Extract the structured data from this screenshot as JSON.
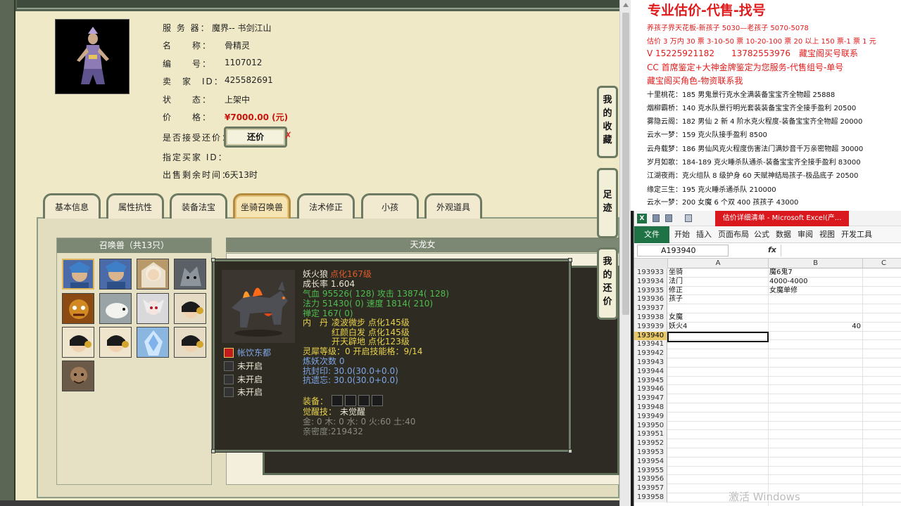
{
  "game": {
    "info": {
      "server_label": "服 务 器：",
      "server_value": "魔界-- 书剑江山",
      "name_label": "名　　称：",
      "name_value": "骨精灵",
      "number_label": "编　　号：",
      "number_value": "1107012",
      "seller_label": "卖　家　ID：",
      "seller_value": "425582691",
      "status_label": "状　　态：",
      "status_value": "上架中",
      "price_label": "价　　格：",
      "price_value": "¥7000.00 (元)",
      "counter_label": "是否接受还价：",
      "counter_button": "还价",
      "counter_no_mark": "✗",
      "buyer_label": "指定买家 ID：",
      "time_label": "出售剩余时间：",
      "time_value": "6天13时"
    },
    "tabs": [
      "基本信息",
      "属性抗性",
      "装备法宝",
      "坐骑召唤兽",
      "法术修正",
      "小孩",
      "外观道具"
    ],
    "active_tab": "坐骑召唤兽",
    "summon_header": "召唤兽（共13只）",
    "detail_header": "天龙女",
    "side_buttons": [
      {
        "label": [
          "我",
          "的",
          "收",
          "藏"
        ]
      },
      {
        "label": [
          "足",
          "迹"
        ]
      },
      {
        "label": [
          "我",
          "的",
          "还",
          "价"
        ]
      }
    ],
    "tooltip": {
      "pet_name": "妖火狼",
      "pet_level": "点化167级",
      "growth": "成长率 1.604",
      "hp": "气血 95526( 128) 攻击 13874( 128)",
      "mp": "法力 51430( 0) 速度 1814( 210)",
      "def": "禅定 167( 0)",
      "neidan_label": "内　丹",
      "neidan_1": "凌波微步 点化145级",
      "neidan_2": "红颜白发 点化145级",
      "neidan_3": "开天辟地 点化123级",
      "lingxi": "灵犀等级：0 开启技能格：9/14",
      "lianyao": "炼妖次数 0",
      "kangfeng": "抗封印: 30.0(30.0+0.0)",
      "kangyi": "抗遗忘: 30.0(30.0+0.0)",
      "equip_label": "装备：",
      "awaken_label": "觉醒技：",
      "awaken_value": "未觉醒",
      "elements": "金: 0 木: 0 水: 0 火:60 土:40",
      "intimacy": "亲密度:219432",
      "skills": [
        "帐饮东都",
        "未开启",
        "未开启",
        "未开启"
      ]
    }
  },
  "panel": {
    "title": "专业估价-代售-找号",
    "logo": "",
    "lines": [
      {
        "text": "养孩子界天花板-新孩子 5030—老孩子 5070-5078",
        "color": "red"
      },
      {
        "text": "估价 3 万内 30 票 3-10-50 票 10-20-100 票 20 以上 150 票-1 票 1 元",
        "color": "red"
      },
      {
        "text": "V 15225921182　　13782553976　藏宝阁买号联系",
        "color": "red",
        "big": true
      },
      {
        "text": "CC 首席鉴定+大神金牌鉴定为您服务-代售组号-单号",
        "color": "red",
        "big": true
      },
      {
        "text": "藏宝阁买角色-物资联系我",
        "color": "red",
        "big": true
      },
      {
        "text": "十里桃花：185 男鬼景行克水全满装备宝宝齐全物超 25888",
        "color": "black"
      },
      {
        "text": "烟柳霸桥：140 克水队景行明光套装装备宝宝齐全接手盈利 20500",
        "color": "black"
      },
      {
        "text": "雾隐云阁：182 男仙 2 新 4 阶水克火程度-装备宝宝齐全物超 20000",
        "color": "black"
      },
      {
        "text": "云水一梦：159 克火队接手盈利 8500",
        "color": "black"
      },
      {
        "text": "云舟载梦：186 男仙风克火程度伤害法门满妙音千万亲密物超 30000",
        "color": "black"
      },
      {
        "text": "岁月如歌：184-189 克火睡杀队通杀-装备宝宝齐全接手盈利 83000",
        "color": "black"
      },
      {
        "text": "江湖夜雨：克火组队 8 级护身 60 天赋神结局孩子-极品底子 20500",
        "color": "black"
      },
      {
        "text": "缘定三生：195 克火睡杀通杀队 210000",
        "color": "black"
      },
      {
        "text": "云水一梦：200 女魔 6 个双 400 孩孩子 43000",
        "color": "black"
      }
    ]
  },
  "excel": {
    "window_title": "估价详细清单 - Microsoft Excel(产...",
    "ribbon_tabs": [
      "文件",
      "开始",
      "插入",
      "页面布局",
      "公式",
      "数据",
      "审阅",
      "视图",
      "开发工具"
    ],
    "name_box": "A193940",
    "fx": "fx",
    "columns": [
      "A",
      "B",
      "C"
    ],
    "rows": [
      {
        "n": "193933",
        "a": "坐骑",
        "b": "魔6鬼7"
      },
      {
        "n": "193934",
        "a": "法门",
        "b": "4000-4000"
      },
      {
        "n": "193935",
        "a": "修正",
        "b": "女魔单修"
      },
      {
        "n": "193936",
        "a": "孩子",
        "b": ""
      },
      {
        "n": "193937",
        "a": "",
        "b": ""
      },
      {
        "n": "193938",
        "a": "女魔",
        "b": ""
      },
      {
        "n": "193939",
        "a": "妖火4",
        "b": "40"
      },
      {
        "n": "193940",
        "a": "",
        "b": ""
      },
      {
        "n": "193941",
        "a": "",
        "b": ""
      },
      {
        "n": "193942",
        "a": "",
        "b": ""
      },
      {
        "n": "193943",
        "a": "",
        "b": ""
      },
      {
        "n": "193944",
        "a": "",
        "b": ""
      },
      {
        "n": "193945",
        "a": "",
        "b": ""
      },
      {
        "n": "193946",
        "a": "",
        "b": ""
      },
      {
        "n": "193947",
        "a": "",
        "b": ""
      },
      {
        "n": "193948",
        "a": "",
        "b": ""
      },
      {
        "n": "193949",
        "a": "",
        "b": ""
      },
      {
        "n": "193950",
        "a": "",
        "b": ""
      },
      {
        "n": "193951",
        "a": "",
        "b": ""
      },
      {
        "n": "193952",
        "a": "",
        "b": ""
      },
      {
        "n": "193953",
        "a": "",
        "b": ""
      },
      {
        "n": "193954",
        "a": "",
        "b": ""
      },
      {
        "n": "193955",
        "a": "",
        "b": ""
      },
      {
        "n": "193956",
        "a": "",
        "b": ""
      },
      {
        "n": "193957",
        "a": "",
        "b": ""
      },
      {
        "n": "193958",
        "a": "",
        "b": ""
      }
    ]
  },
  "watermark": "激活 Windows"
}
